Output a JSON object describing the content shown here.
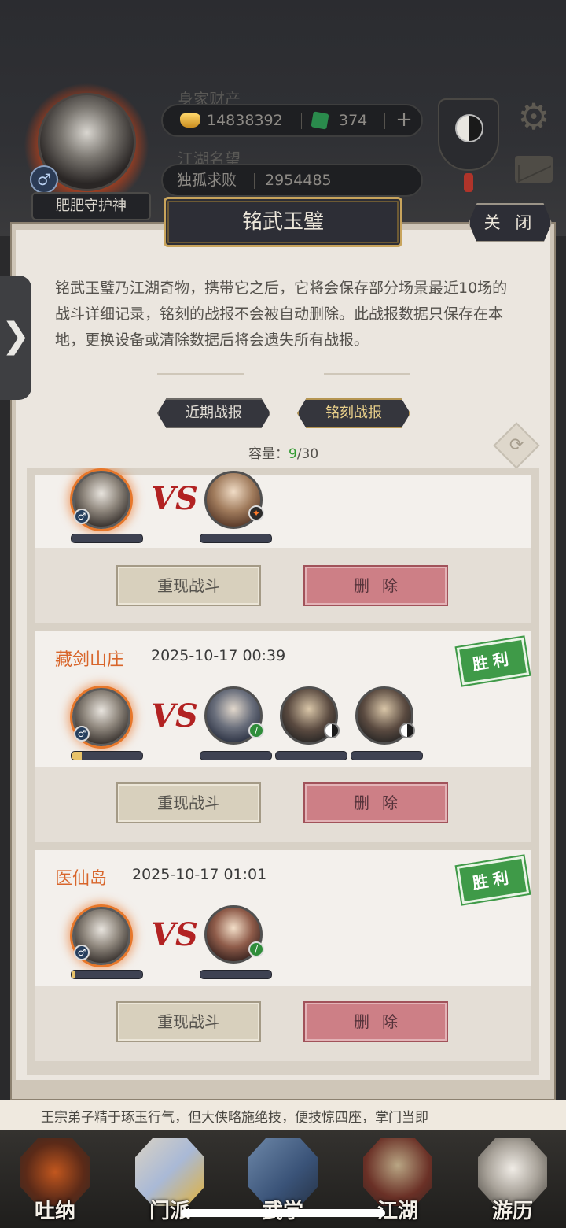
{
  "header": {
    "player_name": "肥肥守护神",
    "wealth_label": "身家财产",
    "gold_amount": "14838392",
    "jade_amount": "374",
    "plus_symbol": "+",
    "reputation_label": "江湖名望",
    "reputation_title": "独孤求败",
    "reputation_value": "2954485",
    "gender_symbol": "♂",
    "gear_symbol": "⚙"
  },
  "side_handle": {
    "symbol": "❯"
  },
  "dialog": {
    "title": "铭武玉璧",
    "close_label": "关 闭",
    "description": "铭武玉璧乃江湖奇物，携带它之后，它将会保存部分场景最近10场的战斗详细记录，铭刻的战报不会被自动删除。此战报数据只保存在本地，更换设备或清除数据后将会遗失所有战报。",
    "tabs": [
      {
        "label": "近期战报",
        "active": false
      },
      {
        "label": "铭刻战报",
        "active": true
      }
    ],
    "capacity": {
      "label": "容量：",
      "used": "9",
      "total": "/30"
    },
    "refresh_symbol": "⟳"
  },
  "records": [
    {
      "location": "",
      "time": "",
      "result": "",
      "player_hp": 0,
      "enemies": [
        {
          "portrait": "straw-hat-swordsman",
          "class_icon": "fire"
        }
      ],
      "replay_label": "重现战斗",
      "delete_label": "删除"
    },
    {
      "location": "藏剑山庄",
      "time": "2025-10-17 00:39",
      "result": "胜利",
      "player_hp": 0.14,
      "enemies": [
        {
          "portrait": "young-swordsman",
          "class_icon": "sword"
        },
        {
          "portrait": "masked-bandit",
          "class_icon": "taiji"
        },
        {
          "portrait": "masked-bandit",
          "class_icon": "taiji"
        }
      ],
      "replay_label": "重现战斗",
      "delete_label": "删除"
    },
    {
      "location": "医仙岛",
      "time": "2025-10-17 01:01",
      "result": "胜利",
      "player_hp": 0.06,
      "enemies": [
        {
          "portrait": "female-healer",
          "class_icon": "sword"
        }
      ],
      "replay_label": "重现战斗",
      "delete_label": "删除"
    }
  ],
  "vs_label": "VS",
  "bottom_ticker": "王宗弟子精于琢玉行气，但大侠略施绝技，便技惊四座，掌门当即",
  "nav": [
    {
      "label": "吐纳"
    },
    {
      "label": "门派"
    },
    {
      "label": "武学"
    },
    {
      "label": "江湖"
    },
    {
      "label": "游历"
    }
  ],
  "colors": {
    "location_text": "#d8652a",
    "win_stamp": "#3f9a48",
    "delete_button": "#cd7f86",
    "capacity_used": "#2f9a2f"
  }
}
